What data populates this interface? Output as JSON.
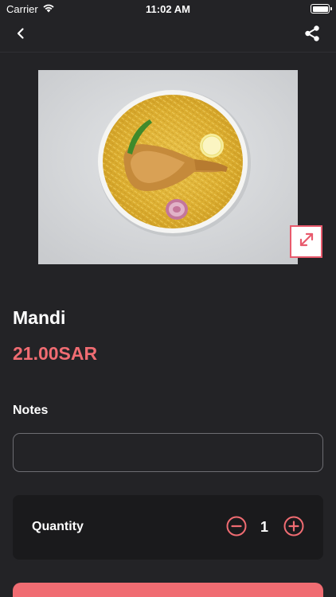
{
  "status_bar": {
    "carrier": "Carrier",
    "time": "11:02 AM"
  },
  "nav": {
    "back_icon": "chevron-left-icon",
    "share_icon": "share-icon"
  },
  "product": {
    "image_alt": "Mandi",
    "name": "Mandi",
    "price": "21.00SAR"
  },
  "notes": {
    "label": "Notes",
    "value": "",
    "placeholder": ""
  },
  "quantity": {
    "label": "Quantity",
    "value": "1"
  },
  "colors": {
    "background": "#232326",
    "accent": "#f06c72",
    "card": "#1a1a1c"
  }
}
